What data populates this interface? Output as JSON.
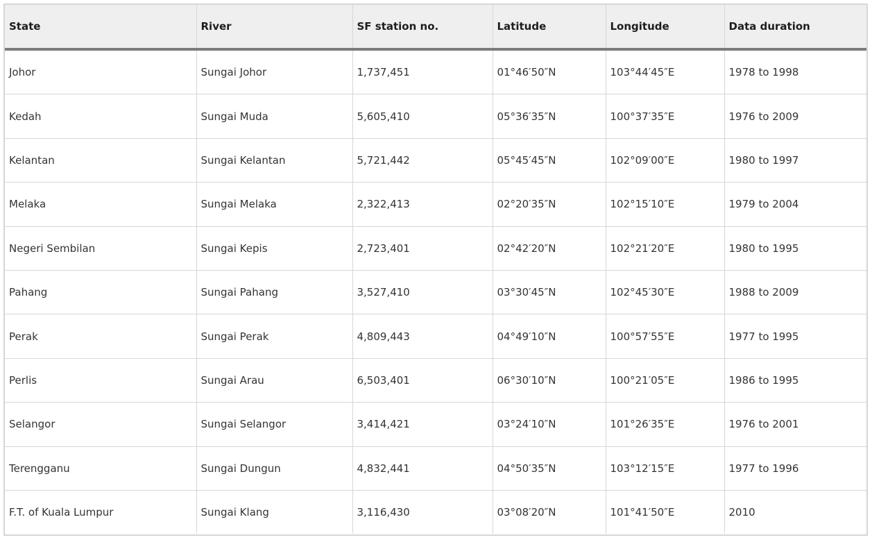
{
  "table": {
    "headers": [
      "State",
      "River",
      "SF station no.",
      "Latitude",
      "Longitude",
      "Data duration"
    ],
    "rows": [
      [
        "Johor",
        "Sungai Johor",
        "1,737,451",
        "01°46′50″N",
        "103°44′45″E",
        "1978 to 1998"
      ],
      [
        "Kedah",
        "Sungai Muda",
        "5,605,410",
        "05°36′35″N",
        "100°37′35″E",
        "1976 to 2009"
      ],
      [
        "Kelantan",
        "Sungai Kelantan",
        "5,721,442",
        "05°45′45″N",
        "102°09′00″E",
        "1980 to 1997"
      ],
      [
        "Melaka",
        "Sungai Melaka",
        "2,322,413",
        "02°20′35″N",
        "102°15′10″E",
        "1979 to 2004"
      ],
      [
        "Negeri Sembilan",
        "Sungai Kepis",
        "2,723,401",
        "02°42′20″N",
        "102°21′20″E",
        "1980 to 1995"
      ],
      [
        "Pahang",
        "Sungai Pahang",
        "3,527,410",
        "03°30′45″N",
        "102°45′30″E",
        "1988 to 2009"
      ],
      [
        "Perak",
        "Sungai Perak",
        "4,809,443",
        "04°49′10″N",
        "100°57′55″E",
        "1977 to 1995"
      ],
      [
        "Perlis",
        "Sungai Arau",
        "6,503,401",
        "06°30′10″N",
        "100°21′05″E",
        "1986 to 1995"
      ],
      [
        "Selangor",
        "Sungai Selangor",
        "3,414,421",
        "03°24′10″N",
        "101°26′35″E",
        "1976 to 2001"
      ],
      [
        "Terengganu",
        "Sungai Dungun",
        "4,832,441",
        "04°50′35″N",
        "103°12′15″E",
        "1977 to 1996"
      ],
      [
        "F.T. of Kuala Lumpur",
        "Sungai Klang",
        "3,116,430",
        "03°08′20″N",
        "101°41′50″E",
        "2010"
      ]
    ]
  }
}
